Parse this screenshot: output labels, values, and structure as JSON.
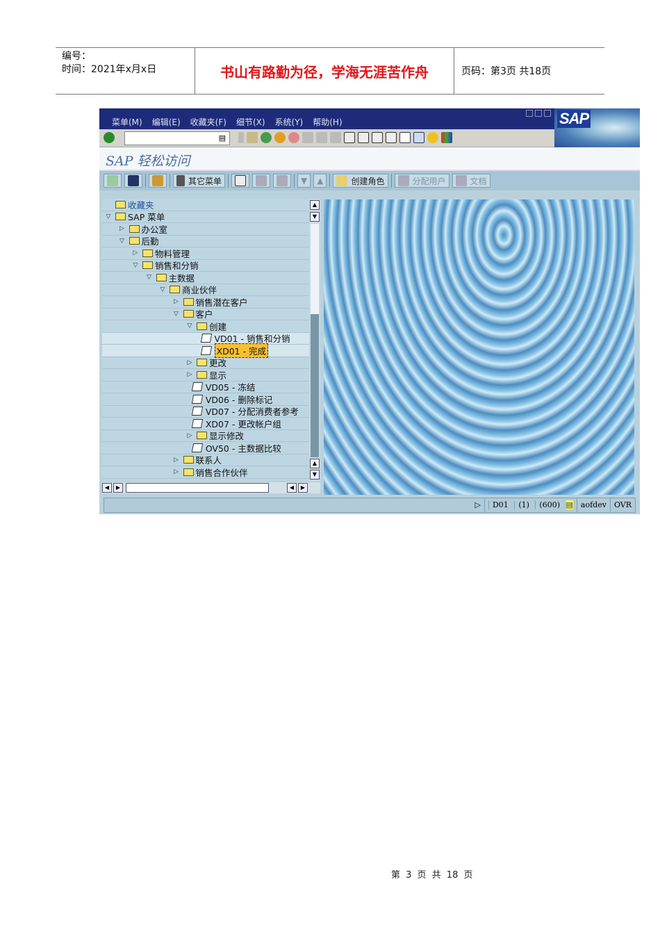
{
  "header": {
    "number_label": "编号：",
    "date_label": "时间：2021年x月x日",
    "motto": "书山有路勤为径，学海无涯苦作舟",
    "page_info": "页码：第3页 共18页"
  },
  "sap": {
    "menu": [
      "菜单(M)",
      "编辑(E)",
      "收藏夹(F)",
      "细节(X)",
      "系统(Y)",
      "帮助(H)"
    ],
    "logo": "SAP",
    "command_value": "",
    "title": "SAP 轻松访问",
    "app_toolbar": {
      "other_menu": "其它菜单",
      "create_role": "创建角色",
      "assign_user": "分配用户",
      "documentation": "文档"
    },
    "tree": [
      {
        "label": "收藏夹",
        "level": 0,
        "type": "folder",
        "expand": "none",
        "color": "#2050a0"
      },
      {
        "label": "SAP 菜单",
        "level": 0,
        "type": "folder",
        "expand": "open"
      },
      {
        "label": "办公室",
        "level": 1,
        "type": "folder",
        "expand": "closed"
      },
      {
        "label": "后勤",
        "level": 1,
        "type": "folder",
        "expand": "open"
      },
      {
        "label": "物料管理",
        "level": 2,
        "type": "folder",
        "expand": "closed"
      },
      {
        "label": "销售和分销",
        "level": 2,
        "type": "folder",
        "expand": "open"
      },
      {
        "label": "主数据",
        "level": 3,
        "type": "folder",
        "expand": "open"
      },
      {
        "label": "商业伙伴",
        "level": 4,
        "type": "folder",
        "expand": "open"
      },
      {
        "label": "销售潜在客户",
        "level": 5,
        "type": "folder",
        "expand": "closed"
      },
      {
        "label": "客户",
        "level": 5,
        "type": "folder",
        "expand": "open"
      },
      {
        "label": "创建",
        "level": 6,
        "type": "folder",
        "expand": "open"
      },
      {
        "label": "VD01 - 销售和分销",
        "level": 7,
        "type": "tx",
        "selected_row": true
      },
      {
        "label": "XD01 - 完成",
        "level": 7,
        "type": "tx",
        "selected_row": true,
        "highlighted": true
      },
      {
        "label": "更改",
        "level": 6,
        "type": "folder",
        "expand": "closed"
      },
      {
        "label": "显示",
        "level": 6,
        "type": "folder",
        "expand": "closed"
      },
      {
        "label": "VD05 - 冻结",
        "level": 6.35,
        "type": "tx"
      },
      {
        "label": "VD06 - 删除标记",
        "level": 6.35,
        "type": "tx"
      },
      {
        "label": "VD07 - 分配消费者参考",
        "level": 6.35,
        "type": "tx"
      },
      {
        "label": "XD07 - 更改帐户组",
        "level": 6.35,
        "type": "tx"
      },
      {
        "label": "显示修改",
        "level": 6,
        "type": "folder",
        "expand": "closed"
      },
      {
        "label": "OV50 - 主数据比较",
        "level": 6.35,
        "type": "tx"
      },
      {
        "label": "联系人",
        "level": 5,
        "type": "folder",
        "expand": "closed"
      },
      {
        "label": "销售合作伙伴",
        "level": 5,
        "type": "folder",
        "expand": "closed"
      }
    ],
    "status": {
      "system": "D01",
      "session": "(1)",
      "client": "(600)",
      "server": "aofdev",
      "mode": "OVR"
    }
  },
  "footer": "第 3 页 共 18 页"
}
